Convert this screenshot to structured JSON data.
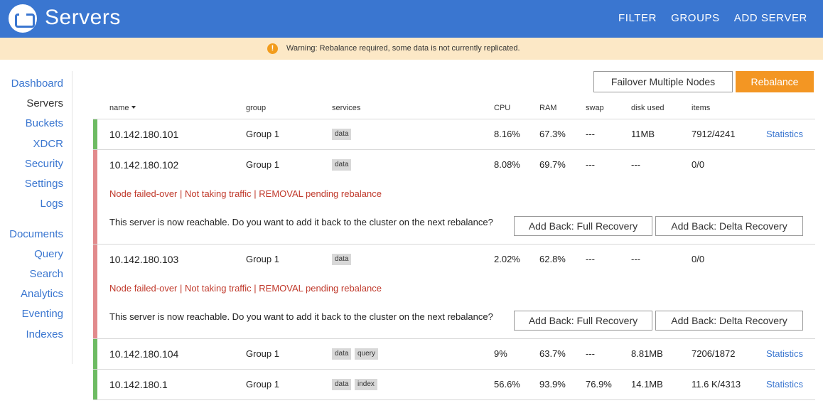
{
  "header": {
    "title": "Servers",
    "nav": [
      "FILTER",
      "GROUPS",
      "ADD SERVER"
    ]
  },
  "warning": {
    "icon": "warning-icon",
    "text": "Warning: Rebalance required, some data is not currently replicated."
  },
  "sidebar": {
    "items": [
      {
        "label": "Dashboard"
      },
      {
        "label": "Servers"
      },
      {
        "label": "Buckets"
      },
      {
        "label": "XDCR"
      },
      {
        "label": "Security"
      },
      {
        "label": "Settings"
      },
      {
        "label": "Logs"
      },
      {
        "label": "Documents"
      },
      {
        "label": "Query"
      },
      {
        "label": "Search"
      },
      {
        "label": "Analytics"
      },
      {
        "label": "Eventing"
      },
      {
        "label": "Indexes"
      }
    ],
    "active": "Servers"
  },
  "actions": {
    "failover": "Failover Multiple Nodes",
    "rebalance": "Rebalance"
  },
  "columns": {
    "name": "name",
    "group": "group",
    "services": "services",
    "cpu": "CPU",
    "ram": "RAM",
    "swap": "swap",
    "disk": "disk used",
    "items": "items"
  },
  "servers": [
    {
      "name": "10.142.180.101",
      "group": "Group 1",
      "services": [
        "data"
      ],
      "cpu": "8.16%",
      "ram": "67.3%",
      "swap": "---",
      "disk": "11MB",
      "items": "7912/4241",
      "stats": "Statistics",
      "status": "green"
    },
    {
      "name": "10.142.180.102",
      "group": "Group 1",
      "services": [
        "data"
      ],
      "cpu": "8.08%",
      "ram": "69.7%",
      "swap": "---",
      "disk": "---",
      "items": "0/0",
      "status": "failed",
      "fail_msg": "Node failed-over | Not taking traffic | REMOVAL pending rebalance",
      "reach_msg": "This server is now reachable. Do you want to add it back to the cluster on the next rebalance?",
      "full_recovery": "Add Back: Full Recovery",
      "delta_recovery": "Add Back: Delta Recovery"
    },
    {
      "name": "10.142.180.103",
      "group": "Group 1",
      "services": [
        "data"
      ],
      "cpu": "2.02%",
      "ram": "62.8%",
      "swap": "---",
      "disk": "---",
      "items": "0/0",
      "status": "failed",
      "fail_msg": "Node failed-over | Not taking traffic | REMOVAL pending rebalance",
      "reach_msg": "This server is now reachable. Do you want to add it back to the cluster on the next rebalance?",
      "full_recovery": "Add Back: Full Recovery",
      "delta_recovery": "Add Back: Delta Recovery"
    },
    {
      "name": "10.142.180.104",
      "group": "Group 1",
      "services": [
        "data",
        "query"
      ],
      "cpu": "9%",
      "ram": "63.7%",
      "swap": "---",
      "disk": "8.81MB",
      "items": "7206/1872",
      "stats": "Statistics",
      "status": "green"
    },
    {
      "name": "10.142.180.1",
      "group": "Group 1",
      "services": [
        "data",
        "index"
      ],
      "cpu": "56.6%",
      "ram": "93.9%",
      "swap": "76.9%",
      "disk": "14.1MB",
      "items": "11.6 K/4313",
      "stats": "Statistics",
      "status": "green"
    }
  ]
}
